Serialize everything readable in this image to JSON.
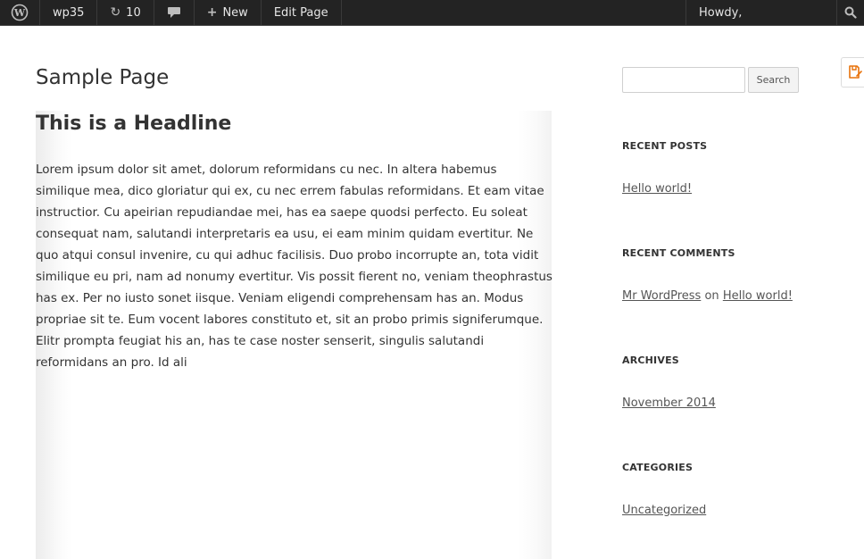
{
  "adminbar": {
    "site_name": "wp35",
    "updates_count": "10",
    "new_label": "New",
    "edit_label": "Edit Page",
    "howdy_label": "Howdy,"
  },
  "page": {
    "title": "Sample Page",
    "headline": "This is a Headline",
    "body": "Lorem ipsum dolor sit amet, dolorum reformidans cu nec. In altera habemus similique mea, dico gloriatur qui ex, cu nec errem fabulas reformidans. Et eam vitae instructior. Cu apeirian repudiandae mei, has ea saepe quodsi perfecto. Eu soleat consequat nam, salutandi interpretaris ea usu, ei eam minim quidam evertitur. Ne quo atqui consul invenire, cu qui adhuc facilisis. Duo probo incorrupte an, tota vidit similique eu pri, nam ad nonumy evertitur. Vis possit fierent no, veniam theophrastus has ex. Per no iusto sonet iisque. Veniam eligendi comprehensam has an. Modus propriae sit te. Eum vocent labores constituto et, sit an probo primis signiferumque. Elitr prompta feugiat his an, has te case noster senserit, singulis salutandi reformidans an pro. Id ali"
  },
  "sidebar": {
    "search_button": "Search",
    "search_value": "",
    "recent_posts": {
      "title": "RECENT POSTS",
      "items": [
        "Hello world!"
      ]
    },
    "recent_comments": {
      "title": "RECENT COMMENTS",
      "author": "Mr WordPress",
      "on": "on",
      "post": "Hello world!"
    },
    "archives": {
      "title": "ARCHIVES",
      "items": [
        "November 2014"
      ]
    },
    "categories": {
      "title": "CATEGORIES",
      "items": [
        "Uncategorized"
      ]
    }
  },
  "colors": {
    "adminbar_bg": "#232323",
    "text": "#333333",
    "link": "#555555",
    "accent_tab": "#e8730c"
  },
  "icons": [
    "wordpress-logo-icon",
    "refresh-icon",
    "comment-bubble-icon",
    "plus-icon",
    "search-icon",
    "note-tab-icon"
  ]
}
